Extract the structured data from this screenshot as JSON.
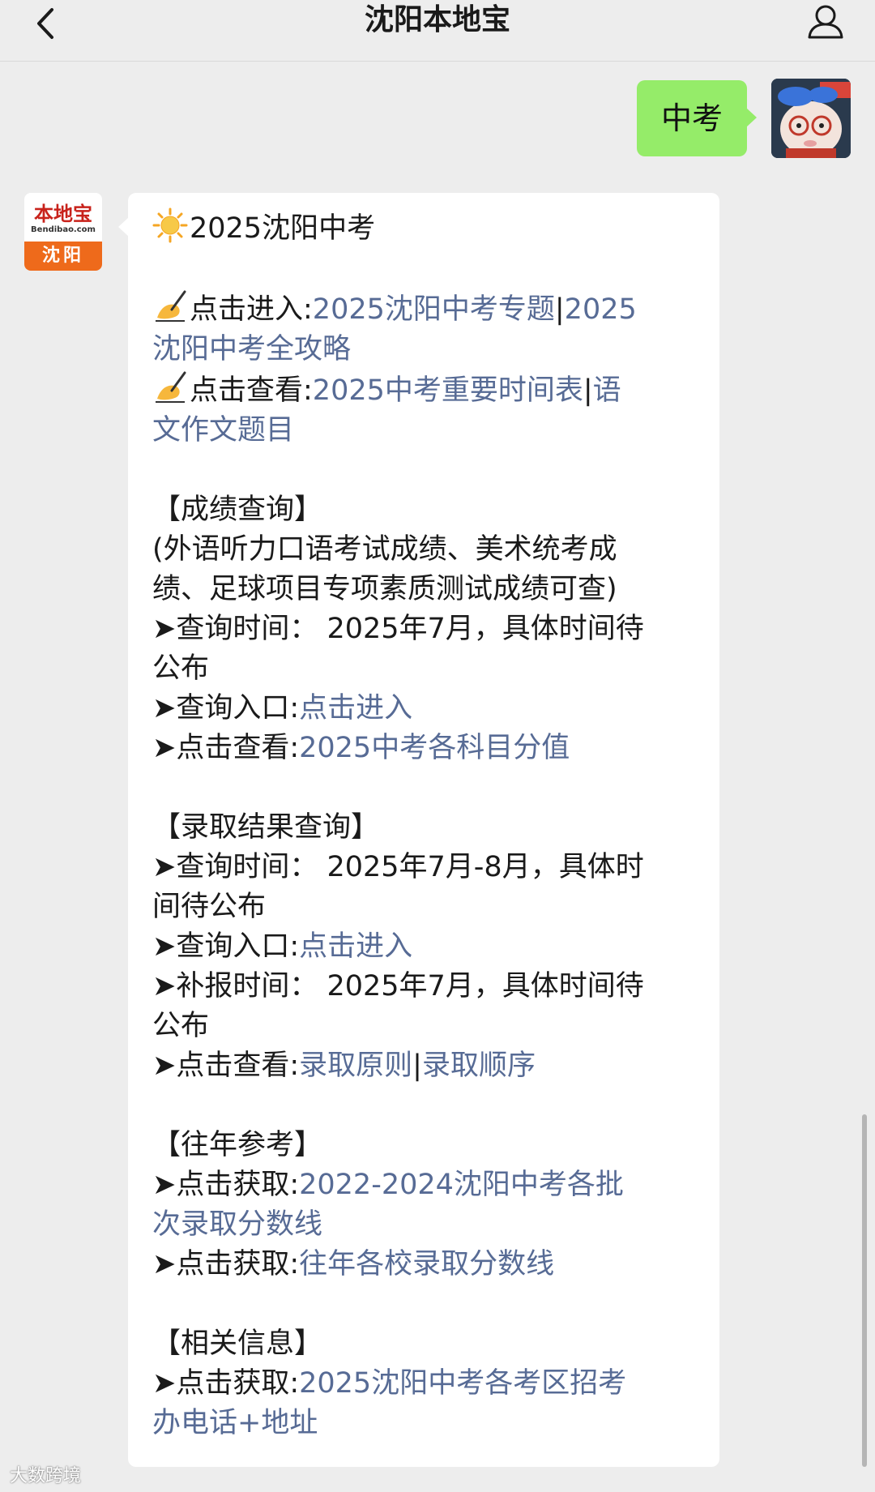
{
  "header": {
    "title": "沈阳本地宝",
    "back_icon": "chevron-left-icon",
    "profile_icon": "person-icon"
  },
  "sent_message": {
    "text": "中考"
  },
  "bot": {
    "logo_text": "本地宝",
    "logo_domain": "Bendibao.com",
    "logo_city": "沈阳"
  },
  "message": {
    "heading": "2025沈阳中考",
    "intro": {
      "enter_label": "点击进入:",
      "enter_link_1": "2025沈阳中考专题",
      "sep": "|",
      "enter_link_2a": "2025",
      "enter_link_2b": "沈阳中考全攻略",
      "view_label": "点击查看:",
      "view_link_1": "2025中考重要时间表",
      "view_link_2a": "语",
      "view_link_2b": "文作文题目"
    },
    "scores": {
      "title": "【成绩查询】",
      "note_1": "(外语听力口语考试成绩、美术统考成",
      "note_2": "绩、足球项目专项素质测试成绩可查)",
      "time_1": "➤查询时间： 2025年7月，具体时间待",
      "time_2": "公布",
      "entry_label": "➤查询入口:",
      "entry_link": "点击进入",
      "view_label": "➤点击查看:",
      "view_link": "2025中考各科目分值"
    },
    "admission": {
      "title": "【录取结果查询】",
      "time_1": "➤查询时间： 2025年7月-8月，具体时",
      "time_2": "间待公布",
      "entry_label": "➤查询入口:",
      "entry_link": "点击进入",
      "supp_1": "➤补报时间： 2025年7月，具体时间待",
      "supp_2": "公布",
      "view_label": "➤点击查看:",
      "view_link_1": "录取原则",
      "view_link_2": "录取顺序"
    },
    "past": {
      "title": "【往年参考】",
      "get_label": "➤点击获取:",
      "get_link_1a": "2022-2024沈阳中考各批",
      "get_link_1b": "次录取分数线",
      "get_link_2": "往年各校录取分数线"
    },
    "related": {
      "title": "【相关信息】",
      "get_label": "➤点击获取:",
      "get_link_a": "2025沈阳中考各考区招考",
      "get_link_b": "办电话+地址"
    }
  },
  "watermark": {
    "text": "大数跨境"
  },
  "icons": {
    "sun": "sun-emoji-icon",
    "writing_hand": "writing-hand-emoji-icon"
  },
  "colors": {
    "background": "#ededed",
    "sent_bubble": "#95ec69",
    "link": "#576b95",
    "logo_band": "#ee6a1b"
  }
}
